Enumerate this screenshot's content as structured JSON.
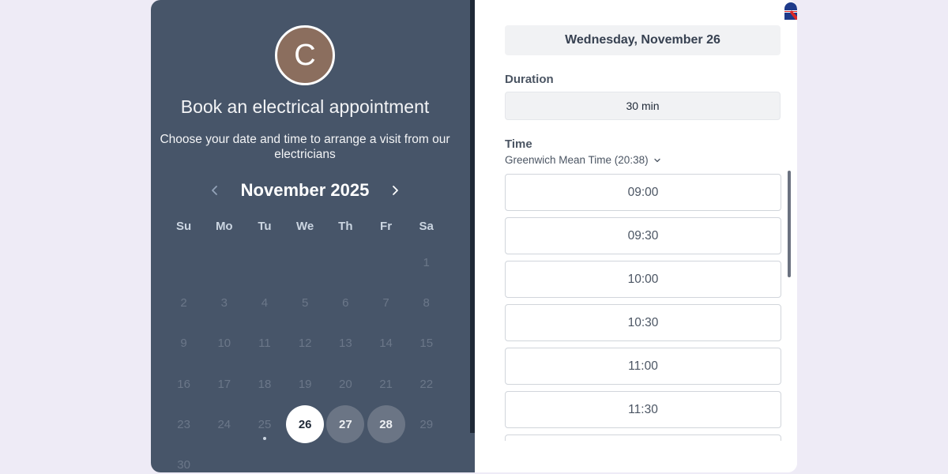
{
  "organizer": {
    "avatar_initial": "C"
  },
  "booking": {
    "title": "Book an electrical appointment",
    "subtitle": "Choose your date and time to arrange a visit from our electricians"
  },
  "calendar": {
    "month_label": "November 2025",
    "weekdays": [
      "Su",
      "Mo",
      "Tu",
      "We",
      "Th",
      "Fr",
      "Sa"
    ],
    "leading_blanks": 6,
    "days": [
      "1",
      "2",
      "3",
      "4",
      "5",
      "6",
      "7",
      "8",
      "9",
      "10",
      "11",
      "12",
      "13",
      "14",
      "15",
      "16",
      "17",
      "18",
      "19",
      "20",
      "21",
      "22",
      "23",
      "24",
      "25",
      "26",
      "27",
      "28",
      "29",
      "30"
    ],
    "today": "25",
    "selected": "26",
    "available": [
      "27",
      "28"
    ]
  },
  "right": {
    "selected_date": "Wednesday, November 26",
    "duration_label": "Duration",
    "duration_value": "30 min",
    "time_label": "Time",
    "timezone": "Greenwich Mean Time (20:38)",
    "slots": [
      "09:00",
      "09:30",
      "10:00",
      "10:30",
      "11:00",
      "11:30",
      ""
    ]
  },
  "colors": {
    "left_panel": "#475569",
    "avatar": "#8b6e5e",
    "page_bg": "#eeebf6"
  },
  "icons": [
    "chevron-left-icon",
    "chevron-right-icon",
    "chevron-down-icon",
    "language-flag-icon"
  ]
}
